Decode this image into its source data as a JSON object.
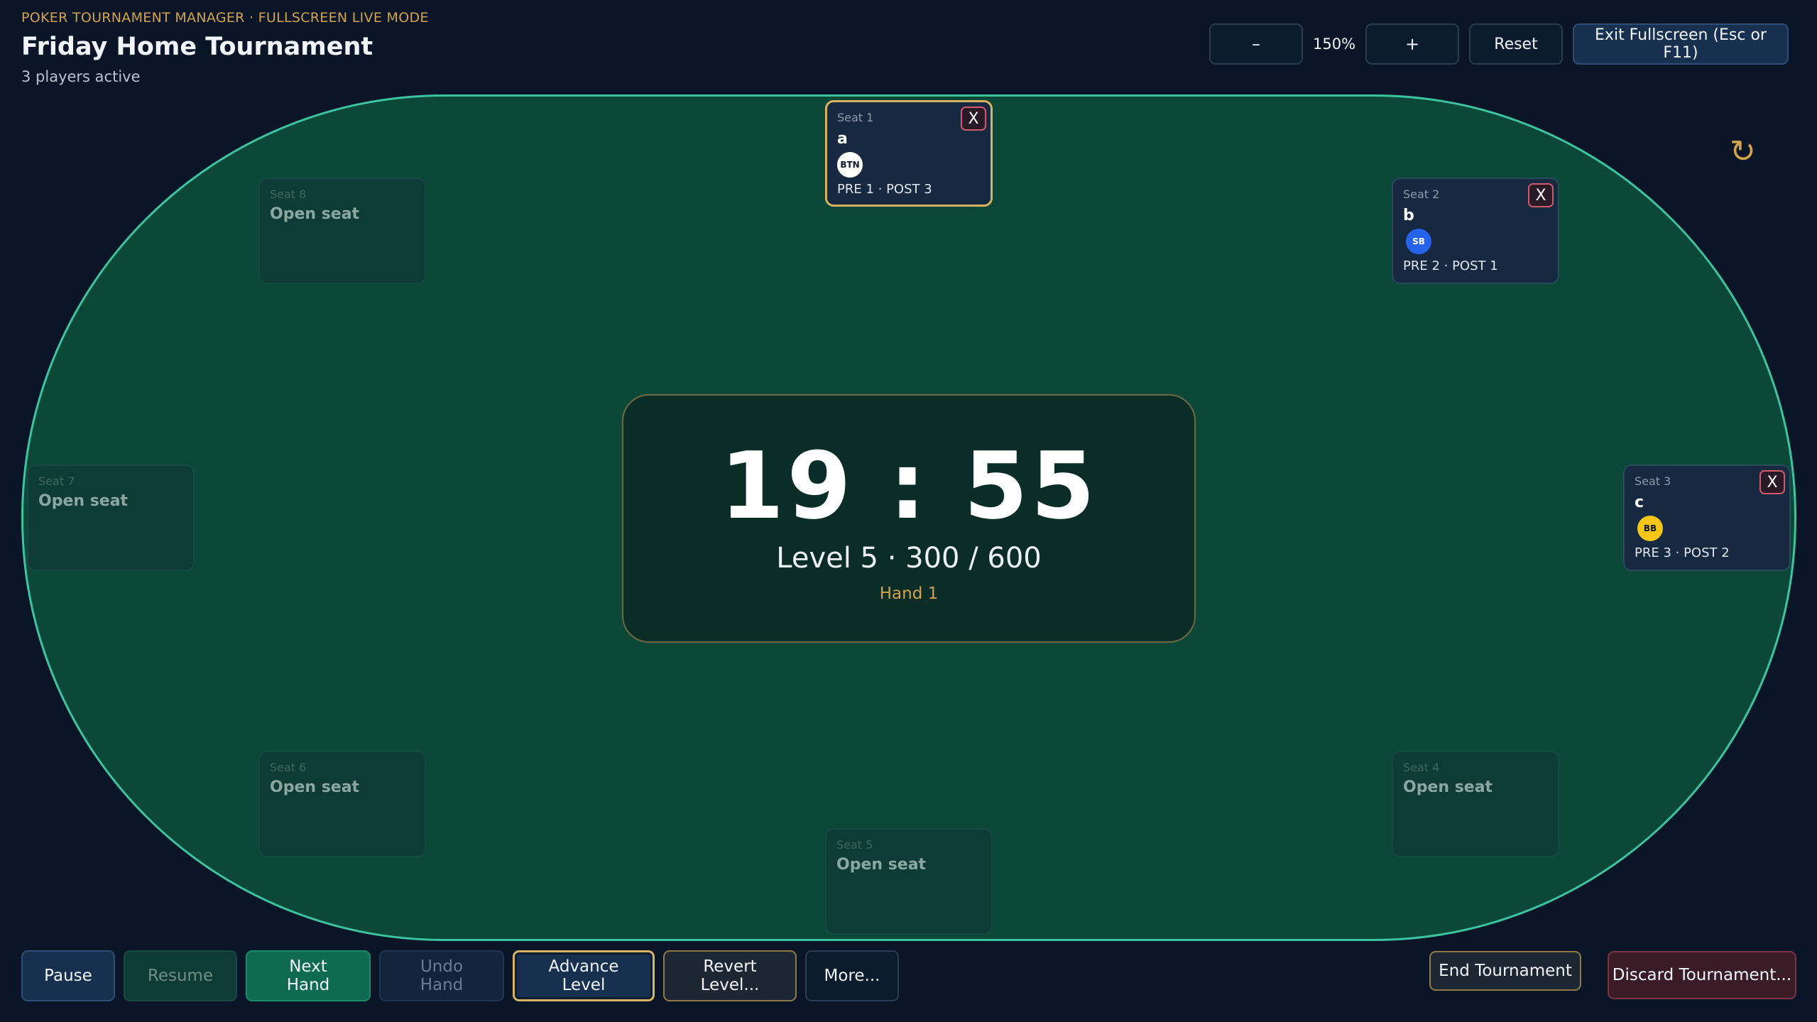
{
  "header": {
    "eyebrow": "POKER TOURNAMENT MANAGER · FULLSCREEN LIVE MODE",
    "title": "Friday Home Tournament",
    "subtitle": "3 players active"
  },
  "zoom": {
    "minus_label": "–",
    "value": "150%",
    "plus_label": "+",
    "reset_label": "Reset",
    "exit_label": "Exit Fullscreen (Esc or F11)"
  },
  "seats": {
    "seat1": {
      "label": "Seat 1",
      "name": "a",
      "chip": "BTN",
      "stats": "PRE 1 · POST 3",
      "remove": "X"
    },
    "seat2": {
      "label": "Seat 2",
      "name": "b",
      "chip": "SB",
      "stats": "PRE 2 · POST 1",
      "remove": "X"
    },
    "seat3": {
      "label": "Seat 3",
      "name": "c",
      "chip": "BB",
      "stats": "PRE 3 · POST 2",
      "remove": "X"
    },
    "seat4": {
      "label": "Seat 4",
      "name": "Open seat"
    },
    "seat5": {
      "label": "Seat 5",
      "name": "Open seat"
    },
    "seat6": {
      "label": "Seat 6",
      "name": "Open seat"
    },
    "seat7": {
      "label": "Seat 7",
      "name": "Open seat"
    },
    "seat8": {
      "label": "Seat 8",
      "name": "Open seat"
    }
  },
  "clock": {
    "time": "19 : 55",
    "level": "Level 5 · 300 / 600",
    "hand": "Hand 1"
  },
  "controls": {
    "pause": "Pause",
    "resume": "Resume",
    "next_hand": "Next Hand",
    "undo_hand": "Undo Hand",
    "advance_level": "Advance Level",
    "revert_level": "Revert Level...",
    "more": "More...",
    "end_tournament": "End Tournament",
    "discard_tournament": "Discard Tournament..."
  },
  "icons": {
    "refresh": "refresh-icon"
  },
  "colors": {
    "background": "#0a1628",
    "felt": "#0b4838",
    "felt_border": "#3cc4a0",
    "accent_gold": "#d4a24c",
    "small_blind": "#2563eb",
    "big_blind": "#f5c518"
  }
}
